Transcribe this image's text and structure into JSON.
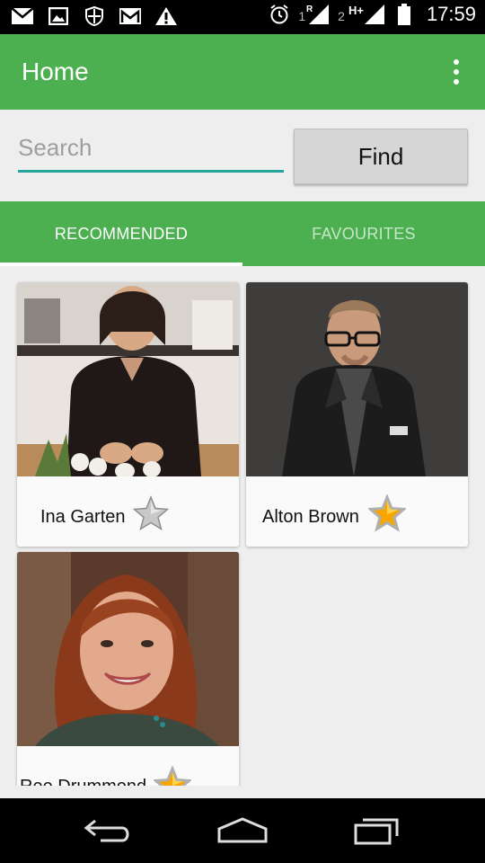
{
  "status_bar": {
    "time": "17:59",
    "sim1_label": "1",
    "sim1_roaming": "R",
    "sim2_label": "2",
    "network_type": "H+",
    "icons": [
      "mail-icon",
      "image-icon",
      "shield-icon",
      "gmail-icon",
      "warning-icon",
      "alarm-icon",
      "signal-icon",
      "battery-icon"
    ]
  },
  "toolbar": {
    "title": "Home",
    "overflow_icon": "more-vert-icon"
  },
  "search": {
    "placeholder": "Search",
    "value": "",
    "button_label": "Find"
  },
  "tabs": [
    {
      "label": "RECOMMENDED",
      "selected": true
    },
    {
      "label": "FAVOURITES",
      "selected": false
    }
  ],
  "chefs": [
    {
      "name": "Ina Garten",
      "favourite": false
    },
    {
      "name": "Alton Brown",
      "favourite": true
    },
    {
      "name": "Ree Drummond",
      "favourite": true
    }
  ],
  "nav_bar": {
    "icons": [
      "back-icon",
      "home-icon",
      "recents-icon"
    ]
  },
  "colors": {
    "primary": "#4caf50",
    "accent": "#26a69a",
    "star_gold": "#f7a600",
    "star_grey": "#b0b0b0"
  }
}
